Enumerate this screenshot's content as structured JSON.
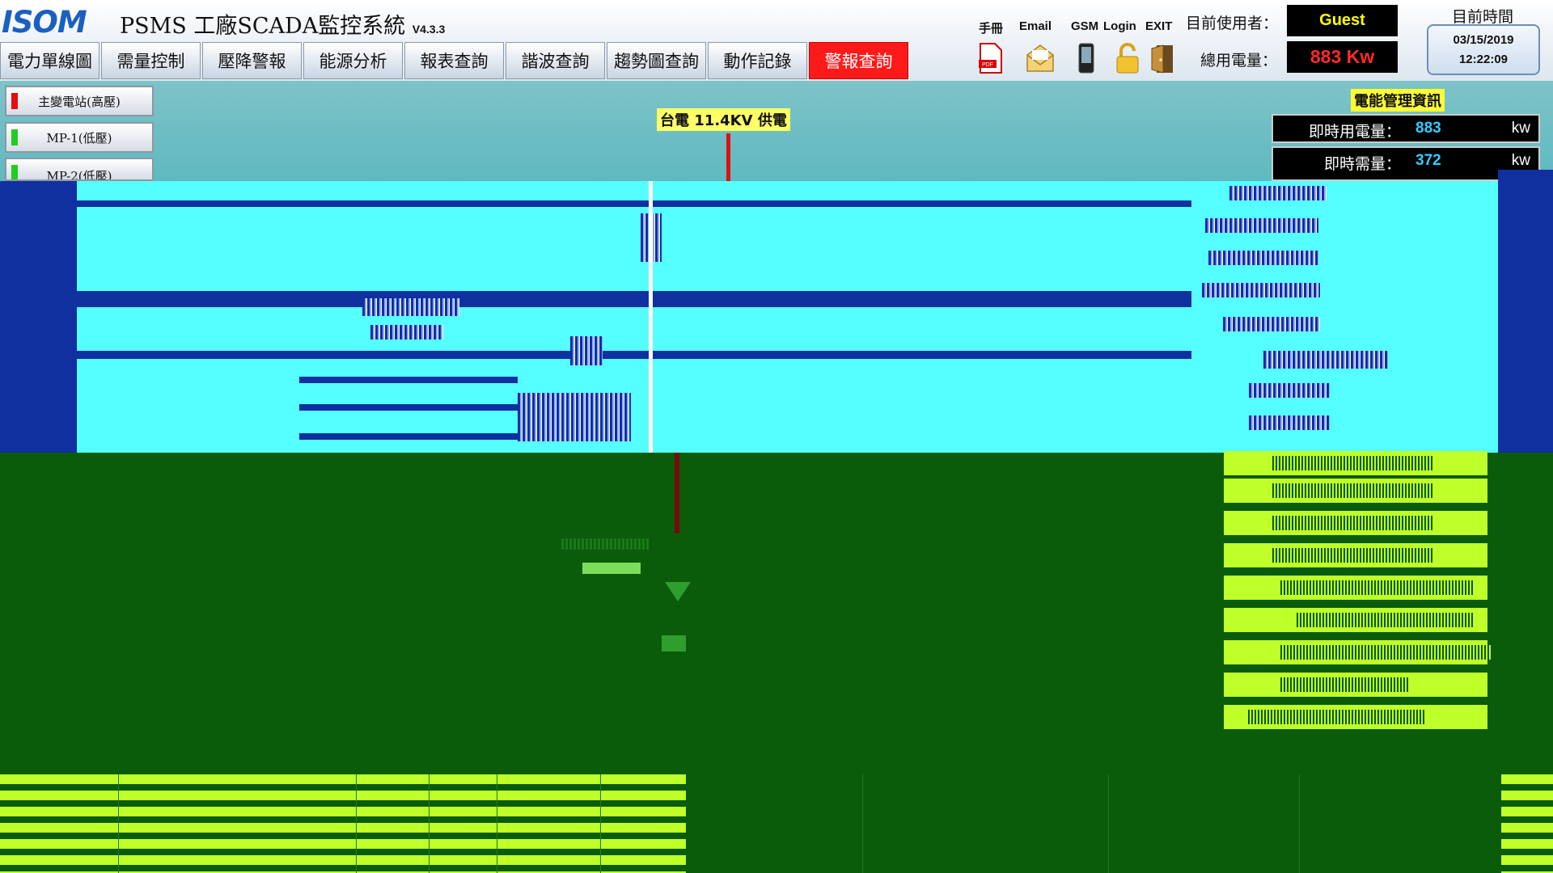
{
  "header": {
    "logo": "ISOM",
    "title": "PSMS 工廠SCADA監控系統",
    "version": "V4.3.3",
    "nav_tabs": [
      {
        "label": "電力單線圖"
      },
      {
        "label": "需量控制"
      },
      {
        "label": "壓降警報"
      },
      {
        "label": "能源分析"
      },
      {
        "label": "報表查詢"
      },
      {
        "label": "諧波查詢"
      },
      {
        "label": "趨勢圖查詢"
      },
      {
        "label": "動作記錄"
      },
      {
        "label": "警報查詢",
        "active": true
      }
    ],
    "tools": [
      {
        "label": "手冊",
        "icon": "pdf-icon"
      },
      {
        "label": "Email",
        "icon": "email-icon"
      },
      {
        "label": "GSM",
        "icon": "phone-icon"
      },
      {
        "label": "Login",
        "icon": "lock-icon"
      },
      {
        "label": "EXIT",
        "icon": "exit-door-icon"
      }
    ],
    "user_label": "目前使用者：",
    "user_value": "Guest",
    "power_label": "總用電量：",
    "power_value": "883 Kw",
    "time_label": "目前時間",
    "date": "03/15/2019",
    "time": "12:22:09"
  },
  "stations": [
    {
      "label": "主變電站(高壓)",
      "status_color": "#e01010"
    },
    {
      "label": "MP-1(低壓)",
      "status_color": "#22cc22"
    },
    {
      "label": "MP-2(低壓)",
      "status_color": "#22cc22"
    }
  ],
  "diagram": {
    "supply_label": "台電 11.4KV 供電"
  },
  "energy_panel": {
    "title": "電能管理資訊",
    "rows": [
      {
        "label": "即時用電量：",
        "value": "883",
        "unit": "kw"
      },
      {
        "label": "即時需量：",
        "value": "372",
        "unit": "kw"
      }
    ]
  },
  "colors": {
    "accent_red": "#ff1a1a",
    "cyan_band": "#55ffff",
    "green_bg": "#0a5c0a",
    "lime": "#bfff2a"
  }
}
